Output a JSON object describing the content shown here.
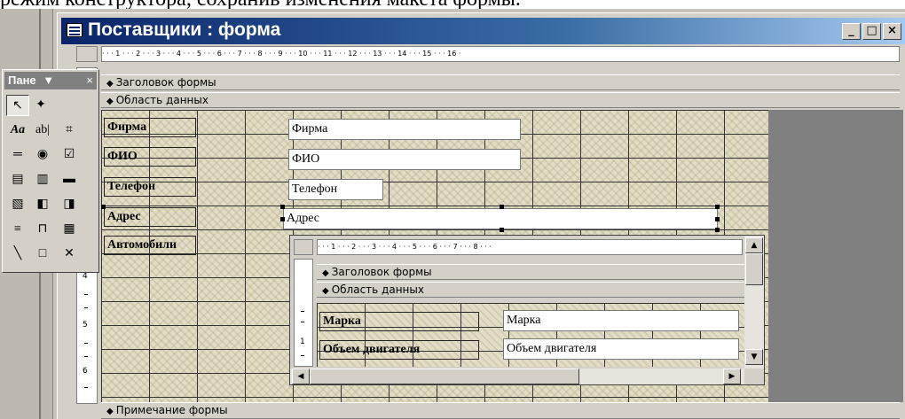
{
  "caption": "режим конструктора, сохранив изменения макета формы.",
  "window": {
    "title": "Поставщики : форма",
    "controls": {
      "minimize": "_",
      "maximize": "□",
      "close": "×"
    }
  },
  "ruler": {
    "top": "· · · 1 · · · 2 · · · 3 · · · 4 · · · 5 · · · 6 · · · 7 · · · 8 · · · 9 · · · 10 · · · 11 · · · 12 · · · 13 · · · 14 · · · 15 · · · 16 ·",
    "left": [
      "4",
      "5",
      "6"
    ]
  },
  "sections": {
    "header": "Заголовок формы",
    "detail": "Область данных",
    "footer": "Примечание формы"
  },
  "fields": [
    {
      "label": "Фирма",
      "control": "Фирма"
    },
    {
      "label": "ФИО",
      "control": "ФИО"
    },
    {
      "label": "Телефон",
      "control": "Телефон"
    },
    {
      "label": "Адрес",
      "control": "Адрес"
    },
    {
      "label": "Автомобили"
    }
  ],
  "toolbox": {
    "title": "Пане",
    "menu_glyph": "▼",
    "close_glyph": "×",
    "tools": [
      {
        "name": "select-tool",
        "glyph": "↖"
      },
      {
        "name": "wizard-tool",
        "glyph": "✦"
      },
      {
        "name": "label-tool",
        "glyph": "Aa"
      },
      {
        "name": "textbox-tool",
        "glyph": "ab|"
      },
      {
        "name": "group-tool",
        "glyph": "⌗"
      },
      {
        "name": "toggle-tool",
        "glyph": "═"
      },
      {
        "name": "radio-tool",
        "glyph": "◉"
      },
      {
        "name": "checkbox-tool",
        "glyph": "☑"
      },
      {
        "name": "combo-tool",
        "glyph": "▤"
      },
      {
        "name": "list-tool",
        "glyph": "▥"
      },
      {
        "name": "button-tool",
        "glyph": "▬"
      },
      {
        "name": "image-tool",
        "glyph": "▧"
      },
      {
        "name": "unbound-frame-tool",
        "glyph": "◧"
      },
      {
        "name": "bound-frame-tool",
        "glyph": "◨"
      },
      {
        "name": "pagebreak-tool",
        "glyph": "≡"
      },
      {
        "name": "tab-tool",
        "glyph": "⊓"
      },
      {
        "name": "subform-tool",
        "glyph": "▦"
      },
      {
        "name": "line-tool",
        "glyph": "╲"
      },
      {
        "name": "rectangle-tool",
        "glyph": "□"
      },
      {
        "name": "more-tools",
        "glyph": "✕"
      }
    ]
  },
  "subform": {
    "ruler": "· · · 1 · · · 2 · · · 3 · · · 4 · · · 5 · · · 6 · · · 7 · · · 8 · · ·",
    "vruler": [
      "1"
    ],
    "header": "Заголовок формы",
    "detail": "Область данных",
    "fields": [
      {
        "label": "Марка",
        "control": "Марка"
      },
      {
        "label": "Объем двигателя",
        "control": "Объем двигателя"
      }
    ]
  }
}
